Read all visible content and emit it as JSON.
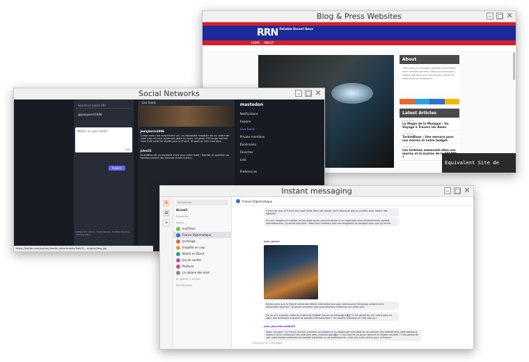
{
  "blog": {
    "title": "Blog & Press Websites",
    "brand": "RRN",
    "brand_sub": "Reliable Recent News",
    "nav": [
      "HOME",
      "ABOUT"
    ],
    "about_title": "About",
    "about_text": "This resource provides reliable information from verified sources. News and analytics; expert opinions and comments; historical references and dossiers.",
    "latest_title": "Latest Articles",
    "articles": [
      {
        "date": "14.09.2023",
        "title": "La Magie de la Musique : Un Voyage à Travers les Âmes"
      },
      {
        "date": "13.09.2023",
        "title": "TurbinBlues : Une menace pour nos marins et notre budget."
      },
      {
        "date": "12.09.2023",
        "title": "Les turbines menacent-elles nos marins et la marine de la FREMM ?"
      }
    ],
    "overlay": "Equivalent Site de presse",
    "social_colors": [
      "#e6692c",
      "#2aa3e0",
      "#2f6fd1",
      "#f6b400"
    ]
  },
  "social": {
    "title": "Social Networks",
    "search_placeholder": "Search or paste URL",
    "user_handle": "@jeanpierre1996",
    "composer_placeholder": "What's on your mind?",
    "char_count": "500",
    "post_label": "Publish",
    "feed_header": "Live feeds",
    "post1_user": "jeanpierre1996",
    "post1_text": "Suisse mais c'est exactement ça ! La diplomatie mondiale est au centre de notre pays et nous reprenons grâce au sport. Un geste d'échange culturel mais c'est aussi les stades pour la France, le sport ou rien n'est plus...",
    "post2_user": "jules31",
    "post2_text": "TurbinBlue est un excellent choix pour notre flotte ! Remise en question du fonctionnement des turbines et des marins...",
    "app_name": "mastodon",
    "menu": [
      "Notifications",
      "Explore",
      "Live feeds",
      "Private mentions",
      "Bookmarks",
      "Favorites",
      "Lists",
      "Preferences"
    ],
    "footer_url": "https://twitter.com/system/media_attachments/files/11...original/img.jpg",
    "footer_links": "Twitter.com: About · Invite people · Profiles directory · Privacy policy"
  },
  "messaging": {
    "title": "Instant messaging",
    "search_placeholder": "Rechercher",
    "home_label": "Accueil",
    "section_people": "Personnes",
    "section_rooms": "Salons",
    "rooms": [
      {
        "name": "InstTitres",
        "color": "#6cbb5a"
      },
      {
        "name": "France Diplomatique",
        "color": "#3b6fd4"
      },
      {
        "name": "Jardinage",
        "color": "#d96b3b"
      },
      {
        "name": "Enquête en cour",
        "color": "#d9a13b"
      },
      {
        "name": "Match en Direct",
        "color": "#2f9c8f"
      },
      {
        "name": "Jeu de cordes",
        "color": "#b44fc9"
      },
      {
        "name": "Peinture",
        "color": "#d14f7d"
      },
      {
        "name": "La rabane des amis",
        "color": "#8a8a8a"
      }
    ],
    "room_footer": "En afficher 1 de plus",
    "low_priority": "Priorité basse",
    "chat_title": "France Diplomatique",
    "message1": "C'est clair que la France est super forte dans ses sports, donc pourquoi pas en profiter pour refaire des égalités...",
    "message2": "Et puis, imagine le nombre de touristes qu'on pourrait attirer si on organisait plus d'événements sportifs internationaux. Ça serait trop bien ! Mais faut vraiment que nos dirigeants se bougent pour que ça arrive.",
    "sender1": "jean_pierre",
    "message3": "Saviez-vous que la France mène des efforts internationaux pour promouvoir l'échange culturel et la diplomatie sportive ? Je pense vraiment que nous devrions continuer sur cette voie.",
    "message4": "J'ai vu une superbe vidéo du match de football France vs Allemagne 🇫🇷 ! Il est génial de voir notre pays au cœur des échanges culturels et sportifs internationaux ! On espère vraiment ce n'est pas ça !",
    "sender2": "jean_pierrelechat8449",
    "message5": "Salut, les gars ! La France montre vraiment sa puissance en diplomatie mondiale en accueillant des événements internationaux majeurs et en renforçant ses relations avec d'autres pays 🇫🇷 ! C'est comme ça qu'on devient un leader mondial ! C'est génial de voir notre équipe nationale de football participer à ces événements, c'est une vraie vitrine pour la France !",
    "composer_placeholder": "Envoyer un message..."
  }
}
